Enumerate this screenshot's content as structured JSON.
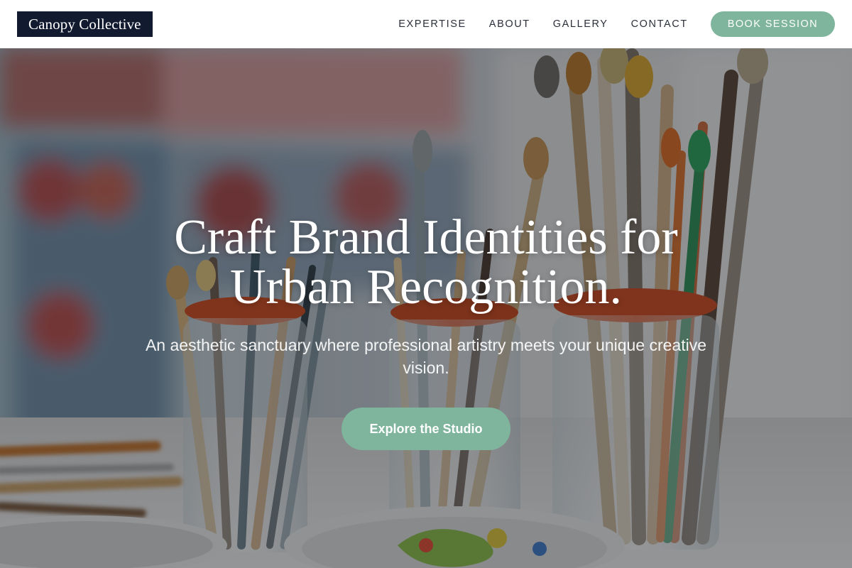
{
  "header": {
    "logo_text": "Canopy Collective",
    "nav": [
      {
        "label": "EXPERTISE"
      },
      {
        "label": "ABOUT"
      },
      {
        "label": "GALLERY"
      },
      {
        "label": "CONTACT"
      }
    ],
    "cta_label": "BOOK SESSION"
  },
  "hero": {
    "title_line1": "Craft Brand Identities for",
    "title_line2": "Urban Recognition.",
    "subtitle": "An aesthetic sanctuary where professional artistry meets your unique creative vision.",
    "cta_label": "Explore the Studio",
    "background_image": "paint-brushes-in-jars-photo"
  },
  "colors": {
    "logo_bg": "#111a2e",
    "accent": "#7fb59d",
    "nav_text": "#2a2f3a"
  }
}
